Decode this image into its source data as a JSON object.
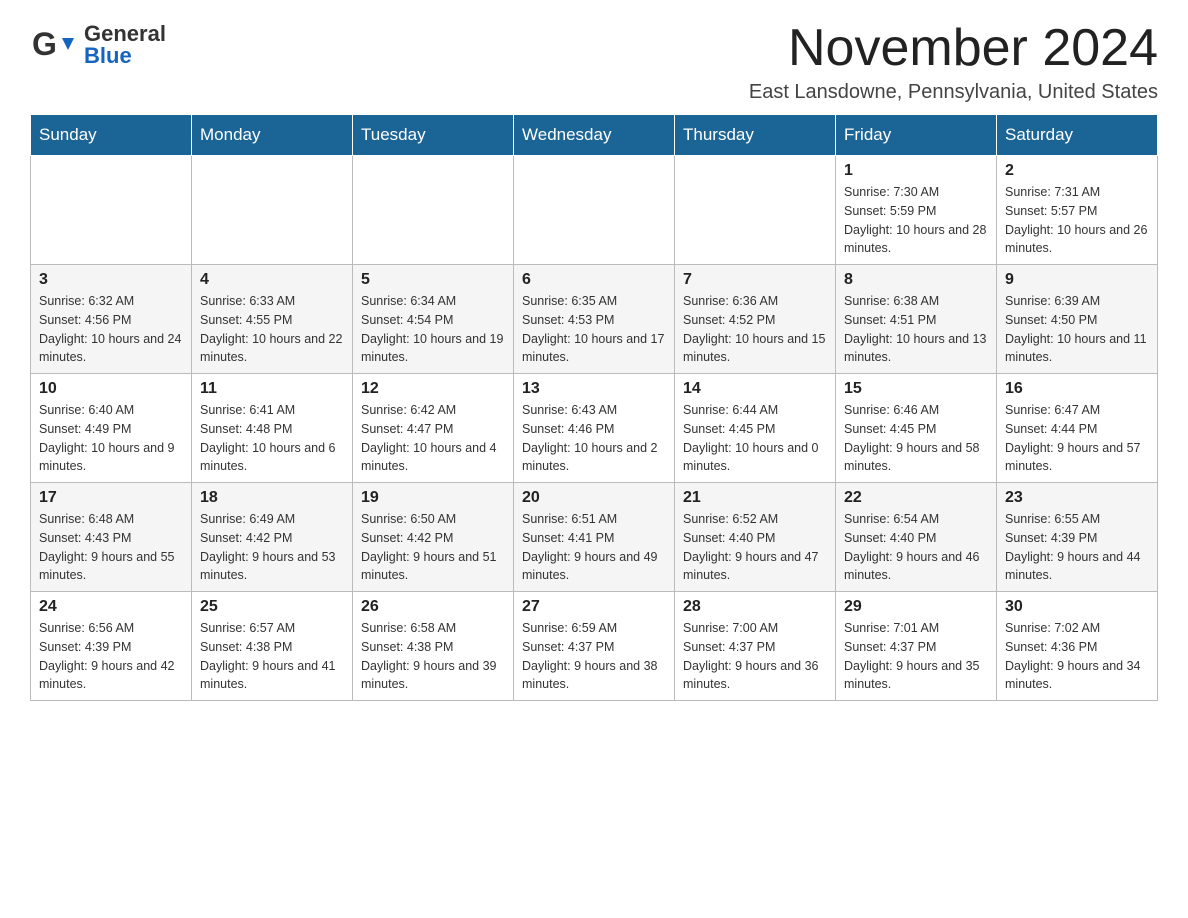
{
  "header": {
    "logo_general": "General",
    "logo_blue": "Blue",
    "month_title": "November 2024",
    "location": "East Lansdowne, Pennsylvania, United States"
  },
  "weekdays": [
    "Sunday",
    "Monday",
    "Tuesday",
    "Wednesday",
    "Thursday",
    "Friday",
    "Saturday"
  ],
  "weeks": [
    [
      {
        "day": "",
        "info": ""
      },
      {
        "day": "",
        "info": ""
      },
      {
        "day": "",
        "info": ""
      },
      {
        "day": "",
        "info": ""
      },
      {
        "day": "",
        "info": ""
      },
      {
        "day": "1",
        "info": "Sunrise: 7:30 AM\nSunset: 5:59 PM\nDaylight: 10 hours and 28 minutes."
      },
      {
        "day": "2",
        "info": "Sunrise: 7:31 AM\nSunset: 5:57 PM\nDaylight: 10 hours and 26 minutes."
      }
    ],
    [
      {
        "day": "3",
        "info": "Sunrise: 6:32 AM\nSunset: 4:56 PM\nDaylight: 10 hours and 24 minutes."
      },
      {
        "day": "4",
        "info": "Sunrise: 6:33 AM\nSunset: 4:55 PM\nDaylight: 10 hours and 22 minutes."
      },
      {
        "day": "5",
        "info": "Sunrise: 6:34 AM\nSunset: 4:54 PM\nDaylight: 10 hours and 19 minutes."
      },
      {
        "day": "6",
        "info": "Sunrise: 6:35 AM\nSunset: 4:53 PM\nDaylight: 10 hours and 17 minutes."
      },
      {
        "day": "7",
        "info": "Sunrise: 6:36 AM\nSunset: 4:52 PM\nDaylight: 10 hours and 15 minutes."
      },
      {
        "day": "8",
        "info": "Sunrise: 6:38 AM\nSunset: 4:51 PM\nDaylight: 10 hours and 13 minutes."
      },
      {
        "day": "9",
        "info": "Sunrise: 6:39 AM\nSunset: 4:50 PM\nDaylight: 10 hours and 11 minutes."
      }
    ],
    [
      {
        "day": "10",
        "info": "Sunrise: 6:40 AM\nSunset: 4:49 PM\nDaylight: 10 hours and 9 minutes."
      },
      {
        "day": "11",
        "info": "Sunrise: 6:41 AM\nSunset: 4:48 PM\nDaylight: 10 hours and 6 minutes."
      },
      {
        "day": "12",
        "info": "Sunrise: 6:42 AM\nSunset: 4:47 PM\nDaylight: 10 hours and 4 minutes."
      },
      {
        "day": "13",
        "info": "Sunrise: 6:43 AM\nSunset: 4:46 PM\nDaylight: 10 hours and 2 minutes."
      },
      {
        "day": "14",
        "info": "Sunrise: 6:44 AM\nSunset: 4:45 PM\nDaylight: 10 hours and 0 minutes."
      },
      {
        "day": "15",
        "info": "Sunrise: 6:46 AM\nSunset: 4:45 PM\nDaylight: 9 hours and 58 minutes."
      },
      {
        "day": "16",
        "info": "Sunrise: 6:47 AM\nSunset: 4:44 PM\nDaylight: 9 hours and 57 minutes."
      }
    ],
    [
      {
        "day": "17",
        "info": "Sunrise: 6:48 AM\nSunset: 4:43 PM\nDaylight: 9 hours and 55 minutes."
      },
      {
        "day": "18",
        "info": "Sunrise: 6:49 AM\nSunset: 4:42 PM\nDaylight: 9 hours and 53 minutes."
      },
      {
        "day": "19",
        "info": "Sunrise: 6:50 AM\nSunset: 4:42 PM\nDaylight: 9 hours and 51 minutes."
      },
      {
        "day": "20",
        "info": "Sunrise: 6:51 AM\nSunset: 4:41 PM\nDaylight: 9 hours and 49 minutes."
      },
      {
        "day": "21",
        "info": "Sunrise: 6:52 AM\nSunset: 4:40 PM\nDaylight: 9 hours and 47 minutes."
      },
      {
        "day": "22",
        "info": "Sunrise: 6:54 AM\nSunset: 4:40 PM\nDaylight: 9 hours and 46 minutes."
      },
      {
        "day": "23",
        "info": "Sunrise: 6:55 AM\nSunset: 4:39 PM\nDaylight: 9 hours and 44 minutes."
      }
    ],
    [
      {
        "day": "24",
        "info": "Sunrise: 6:56 AM\nSunset: 4:39 PM\nDaylight: 9 hours and 42 minutes."
      },
      {
        "day": "25",
        "info": "Sunrise: 6:57 AM\nSunset: 4:38 PM\nDaylight: 9 hours and 41 minutes."
      },
      {
        "day": "26",
        "info": "Sunrise: 6:58 AM\nSunset: 4:38 PM\nDaylight: 9 hours and 39 minutes."
      },
      {
        "day": "27",
        "info": "Sunrise: 6:59 AM\nSunset: 4:37 PM\nDaylight: 9 hours and 38 minutes."
      },
      {
        "day": "28",
        "info": "Sunrise: 7:00 AM\nSunset: 4:37 PM\nDaylight: 9 hours and 36 minutes."
      },
      {
        "day": "29",
        "info": "Sunrise: 7:01 AM\nSunset: 4:37 PM\nDaylight: 9 hours and 35 minutes."
      },
      {
        "day": "30",
        "info": "Sunrise: 7:02 AM\nSunset: 4:36 PM\nDaylight: 9 hours and 34 minutes."
      }
    ]
  ]
}
